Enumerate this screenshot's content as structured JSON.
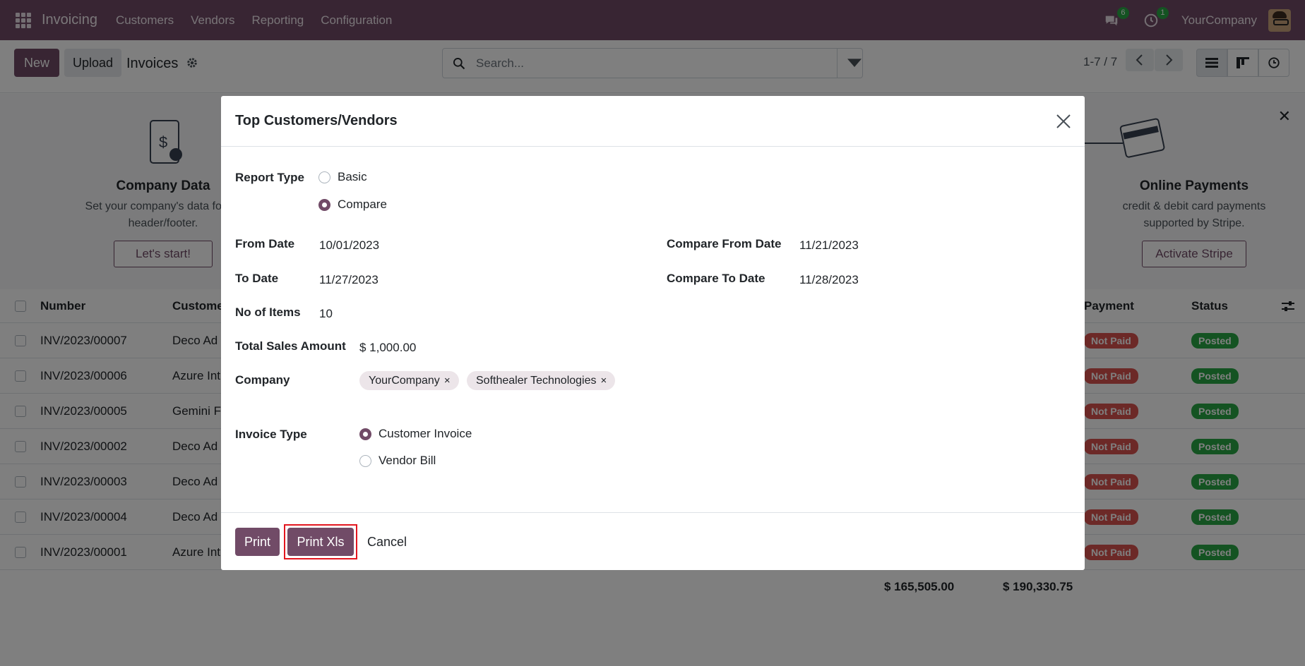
{
  "navbar": {
    "app_name": "Invoicing",
    "menu": [
      "Customers",
      "Vendors",
      "Reporting",
      "Configuration"
    ],
    "messages_count": "6",
    "activities_count": "1",
    "company": "YourCompany"
  },
  "control": {
    "new_label": "New",
    "upload_label": "Upload",
    "title": "Invoices",
    "search_placeholder": "Search...",
    "pager": "1-7 / 7"
  },
  "banner": {
    "company_data": {
      "title": "Company Data",
      "line1": "Set your company's data for do",
      "line2": "header/footer.",
      "button": "Let's start!"
    },
    "online_payments": {
      "title": "Online Payments",
      "line1": "credit & debit card payments",
      "line2": "supported by Stripe.",
      "button": "Activate Stripe"
    }
  },
  "list": {
    "headers": {
      "number": "Number",
      "customer": "Custome",
      "payment": "Payment",
      "status": "Status"
    },
    "rows": [
      {
        "number": "INV/2023/00007",
        "customer": "Deco Ad",
        "payment": "Not Paid",
        "status": "Posted"
      },
      {
        "number": "INV/2023/00006",
        "customer": "Azure Int",
        "payment": "Not Paid",
        "status": "Posted"
      },
      {
        "number": "INV/2023/00005",
        "customer": "Gemini F",
        "payment": "Not Paid",
        "status": "Posted"
      },
      {
        "number": "INV/2023/00002",
        "customer": "Deco Ad",
        "payment": "Not Paid",
        "status": "Posted"
      },
      {
        "number": "INV/2023/00003",
        "customer": "Deco Ad",
        "payment": "Not Paid",
        "status": "Posted"
      },
      {
        "number": "INV/2023/00004",
        "customer": "Deco Ad",
        "payment": "Not Paid",
        "status": "Posted"
      },
      {
        "number": "INV/2023/00001",
        "customer": "Azure Int",
        "payment": "Not Paid",
        "status": "Posted"
      }
    ],
    "total_untaxed": "$ 165,505.00",
    "total": "$ 190,330.75"
  },
  "modal": {
    "title": "Top Customers/Vendors",
    "report_type": {
      "label": "Report Type",
      "options": [
        "Basic",
        "Compare"
      ],
      "selected": "Compare"
    },
    "from_date": {
      "label": "From Date",
      "value": "10/01/2023"
    },
    "to_date": {
      "label": "To Date",
      "value": "11/27/2023"
    },
    "compare_from_date": {
      "label": "Compare From Date",
      "value": "11/21/2023"
    },
    "compare_to_date": {
      "label": "Compare To Date",
      "value": "11/28/2023"
    },
    "no_of_items": {
      "label": "No of Items",
      "value": "10"
    },
    "total_sales_amount": {
      "label": "Total Sales Amount",
      "value": "$ 1,000.00"
    },
    "company": {
      "label": "Company",
      "tags": [
        "YourCompany",
        "Softhealer Technologies"
      ]
    },
    "invoice_type": {
      "label": "Invoice Type",
      "options": [
        "Customer Invoice",
        "Vendor Bill"
      ],
      "selected": "Customer Invoice"
    },
    "buttons": {
      "print": "Print",
      "print_xls": "Print Xls",
      "cancel": "Cancel"
    }
  }
}
